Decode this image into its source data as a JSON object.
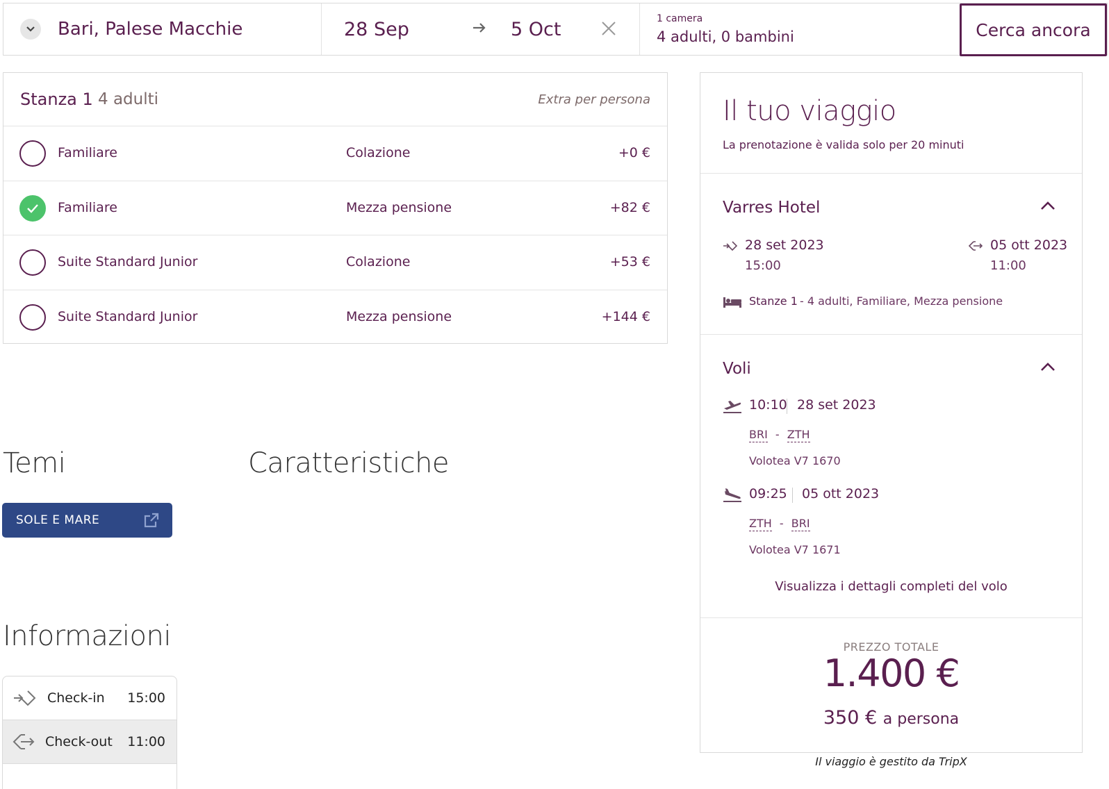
{
  "search": {
    "origin": "Bari, Palese Macchie",
    "date_from": "28 Sep",
    "date_to": "5 Oct",
    "rooms_label": "1 camera",
    "guests": "4 adulti, 0 bambini",
    "button": "Cerca ancora"
  },
  "room_select": {
    "title": "Stanza 1",
    "occupants": "4 adulti",
    "extra_label": "Extra per persona",
    "options": [
      {
        "room": "Familiare",
        "board": "Colazione",
        "price": "+0 €",
        "selected": false
      },
      {
        "room": "Familiare",
        "board": "Mezza pensione",
        "price": "+82 €",
        "selected": true
      },
      {
        "room": "Suite Standard Junior",
        "board": "Colazione",
        "price": "+53 €",
        "selected": false
      },
      {
        "room": "Suite Standard Junior",
        "board": "Mezza pensione",
        "price": "+144 €",
        "selected": false
      }
    ]
  },
  "themes": {
    "heading": "Temi",
    "tag": "SOLE E MARE"
  },
  "features": {
    "heading": "Caratteristiche"
  },
  "info": {
    "heading": "Informazioni",
    "checkin_label": "Check-in",
    "checkin_time": "15:00",
    "checkout_label": "Check-out",
    "checkout_time": "11:00"
  },
  "trip": {
    "title": "Il tuo viaggio",
    "validity": "La prenotazione è valida solo per 20 minuti",
    "hotel": {
      "name": "Varres Hotel",
      "checkin_date": "28 set 2023",
      "checkin_time": "15:00",
      "checkout_date": "05 ott 2023",
      "checkout_time": "11:00",
      "rooms_label": "Stanze 1",
      "rooms_detail": "- 4 adulti, Familiare, Mezza pensione"
    },
    "flights": {
      "heading": "Voli",
      "outbound": {
        "time": "10:10",
        "date": "28 set 2023",
        "from": "BRI",
        "to": "ZTH",
        "carrier": "Volotea V7 1670"
      },
      "return": {
        "time": "09:25",
        "date": "05 ott 2023",
        "from": "ZTH",
        "to": "BRI",
        "carrier": "Volotea V7 1671"
      },
      "details_link": "Visualizza i dettagli completi del volo"
    },
    "price": {
      "label": "PREZZO TOTALE",
      "total": "1.400 €",
      "per_person": "350 €",
      "per_person_suffix": "a persona"
    },
    "managed_by": "Il viaggio è gestito da TripX"
  },
  "colors": {
    "primary": "#5a1f4f",
    "selected": "#4cc36b",
    "tag": "#2e4886"
  }
}
